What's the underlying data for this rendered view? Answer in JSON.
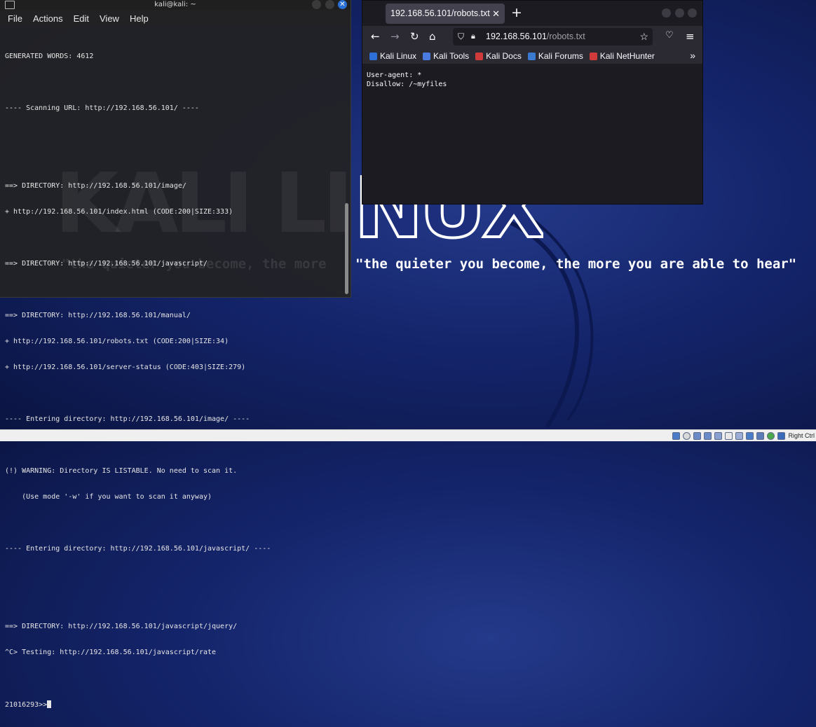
{
  "desktop": {
    "logo_text": "NUX",
    "quote": "\"the quieter you become, the more you are able to hear\""
  },
  "terminal": {
    "title": "kali@kali: ~",
    "menu": [
      "File",
      "Actions",
      "Edit",
      "View",
      "Help"
    ],
    "lines": [
      "GENERATED WORDS: 4612",
      "",
      "---- Scanning URL: http://192.168.56.101/ ----",
      "",
      "",
      "==> DIRECTORY: http://192.168.56.101/image/",
      "+ http://192.168.56.101/index.html (CODE:200|SIZE:333)",
      "",
      "==> DIRECTORY: http://192.168.56.101/javascript/",
      "",
      "==> DIRECTORY: http://192.168.56.101/manual/",
      "+ http://192.168.56.101/robots.txt (CODE:200|SIZE:34)",
      "+ http://192.168.56.101/server-status (CODE:403|SIZE:279)",
      "",
      "---- Entering directory: http://192.168.56.101/image/ ----",
      "",
      "(!) WARNING: Directory IS LISTABLE. No need to scan it.",
      "    (Use mode '-w' if you want to scan it anyway)",
      "",
      "---- Entering directory: http://192.168.56.101/javascript/ ----",
      "",
      "",
      "==> DIRECTORY: http://192.168.56.101/javascript/jquery/",
      "^C> Testing: http://192.168.56.101/javascript/rate",
      "",
      "21016293>>"
    ]
  },
  "browser": {
    "tab_title": "192.168.56.101/robots.txt",
    "url_host": "192.168.56.101",
    "url_path": "/robots.txt",
    "bookmarks": [
      {
        "label": "Kali Linux",
        "icon": "kali-dragon-icon",
        "color": "#2d6fd6"
      },
      {
        "label": "Kali Tools",
        "icon": "kali-tools-icon",
        "color": "#4a7ce0"
      },
      {
        "label": "Kali Docs",
        "icon": "kali-docs-icon",
        "color": "#d03a3a"
      },
      {
        "label": "Kali Forums",
        "icon": "kali-forums-icon",
        "color": "#3a7ad0"
      },
      {
        "label": "Kali NetHunter",
        "icon": "kali-nethunter-icon",
        "color": "#d03a3a"
      }
    ],
    "content": "User-agent: *\nDisallow: /~myfiles"
  },
  "hostbar": {
    "host_key": "Right Ctrl"
  }
}
